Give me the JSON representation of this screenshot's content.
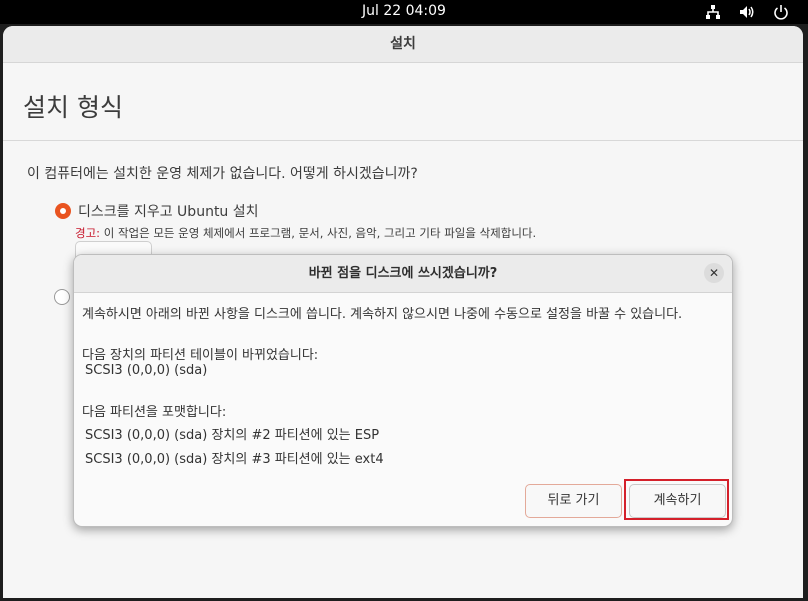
{
  "topbar": {
    "clock": "Jul 22  04:09",
    "icons": [
      "network-icon",
      "volume-icon",
      "power-icon"
    ]
  },
  "window": {
    "title": "설치"
  },
  "installer": {
    "page_title": "설치 형식",
    "question": "이 컴퓨터에는 설치한 운영 체제가 없습니다. 어떻게 하시겠습니까?",
    "option_erase_label": "디스크를 지우고 Ubuntu 설치",
    "option_erase_selected": true,
    "warning_prefix": "경고:",
    "warning_text": " 이 작업은 모든 운영 체제에서 프로그램, 문서, 사진, 음악, 그리고 기타 파일을 삭제합니다."
  },
  "dialog": {
    "title": "바뀐 점을 디스크에 쓰시겠습니까?",
    "close_glyph": "✕",
    "intro": "계속하시면 아래의 바뀐 사항을 디스크에 씁니다. 계속하지 않으시면 나중에 수동으로 설정을 바꿀 수 있습니다.",
    "partition_table_heading": "다음 장치의 파티션 테이블이 바뀌었습니다:",
    "partition_table_devices": [
      "SCSI3 (0,0,0) (sda)"
    ],
    "format_heading": "다음 파티션을 포맷합니다:",
    "format_items": [
      "SCSI3 (0,0,0) (sda) 장치의 #2 파티션에 있는 ESP",
      "SCSI3 (0,0,0) (sda) 장치의 #3 파티션에 있는 ext4"
    ],
    "back_label": "뒤로 가기",
    "continue_label": "계속하기"
  },
  "colors": {
    "accent": "#e95420",
    "warning": "#c7162b",
    "highlight_outline": "#d4202a"
  }
}
